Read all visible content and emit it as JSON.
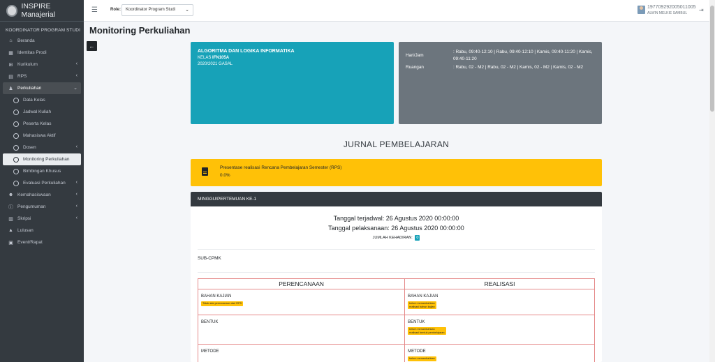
{
  "brand": {
    "title": "INSPIRE Manajerial"
  },
  "sidebar": {
    "header": "KOORDINATOR PROGRAM STUDI",
    "items": [
      {
        "label": "Beranda",
        "icon": "home-icon"
      },
      {
        "label": "Identitas Prodi",
        "icon": "building-icon"
      },
      {
        "label": "Kurikulum",
        "icon": "table-icon",
        "chevron": "‹"
      },
      {
        "label": "RPS",
        "icon": "file-icon",
        "chevron": "‹"
      },
      {
        "label": "Perkuliahan",
        "icon": "users-icon",
        "chevron": "⌄"
      }
    ],
    "sub_items": [
      {
        "label": "Data Kelas"
      },
      {
        "label": "Jadwal Kuliah"
      },
      {
        "label": "Peserta Kelas"
      },
      {
        "label": "Mahasiswa Aktif"
      },
      {
        "label": "Dosen",
        "chevron": "‹"
      },
      {
        "label": "Monitoring Perkuliahan"
      },
      {
        "label": "Bimbingan Khusus"
      },
      {
        "label": "Evaluasi Perkuliahan",
        "chevron": "‹"
      }
    ],
    "items_after": [
      {
        "label": "Kemahasiswaan",
        "icon": "students-icon",
        "chevron": "‹"
      },
      {
        "label": "Pengumuman",
        "icon": "info-icon",
        "chevron": "‹"
      },
      {
        "label": "Skripsi",
        "icon": "document-icon",
        "chevron": "‹"
      },
      {
        "label": "Lulusan",
        "icon": "graduation-cap-icon"
      },
      {
        "label": "Event/Rapat",
        "icon": "calendar-icon"
      }
    ]
  },
  "topbar": {
    "role_label": "Role:",
    "role_value": "Koordinator Program Studi",
    "user_id": "197709292005011005",
    "user_name": "ALWIN MELKIE SAMBUL"
  },
  "page": {
    "title": "Monitoring Perkuliahan"
  },
  "course": {
    "name": "ALGORITMA DAN LOGIKA INFORMATIKA",
    "kelas_prefix": "KELAS",
    "kelas_code": "IFN105A",
    "semester": "2020/2021 GASAL"
  },
  "schedule": {
    "hari_label": "Hari/Jam",
    "hari_value": ": Rabu, 09:40-12:10 | Rabu, 09:40-12:10 | Kamis, 09:40-11:20 | Kamis, 09:40-11:20",
    "ruangan_label": "Ruangan",
    "ruangan_value": ": Rabu, 02 - M2 | Rabu, 02 - M2 | Kamis, 02 - M2 | Kamis, 02 - M2"
  },
  "jurnal": {
    "title": "JURNAL PEMBELAJARAN",
    "rps_label": "Presentase realisasi Rencana Pembelajaran Semester (RPS)",
    "rps_value": "0.0%"
  },
  "meeting": {
    "header": "MINGGU/PERTEMUAN KE-1",
    "tanggal_terjadwal": "Tanggal terjadwal: 26 Agustus 2020 00:00:00",
    "tanggal_pelaksanaan": "Tanggal pelaksanaan: 26 Agustus 2020 00:00:00",
    "jumlah_label": "JUMLAH KEHADIRAN:",
    "jumlah_value": "0",
    "subcpmk": "SUB-CPMK",
    "col_plan": "PERENCANAAN",
    "col_real": "REALISASI",
    "rows": [
      {
        "plan_label": "BAHAN KAJIAN",
        "plan_badge": "Tidak ada perencanaan dari RPS",
        "real_label": "BAHAN KAJIAN",
        "real_badge_1": "belum menambahkan",
        "real_badge_2": "realisasi bahan kajian"
      },
      {
        "plan_label": "BENTUK",
        "real_label": "BENTUK",
        "real_badge_1": "belum menambahkan",
        "real_badge_2": "realisasi bentuk pembelajaran"
      },
      {
        "plan_label": "METODE",
        "real_label": "METODE",
        "real_badge_1": "belum menambahkan"
      }
    ]
  }
}
